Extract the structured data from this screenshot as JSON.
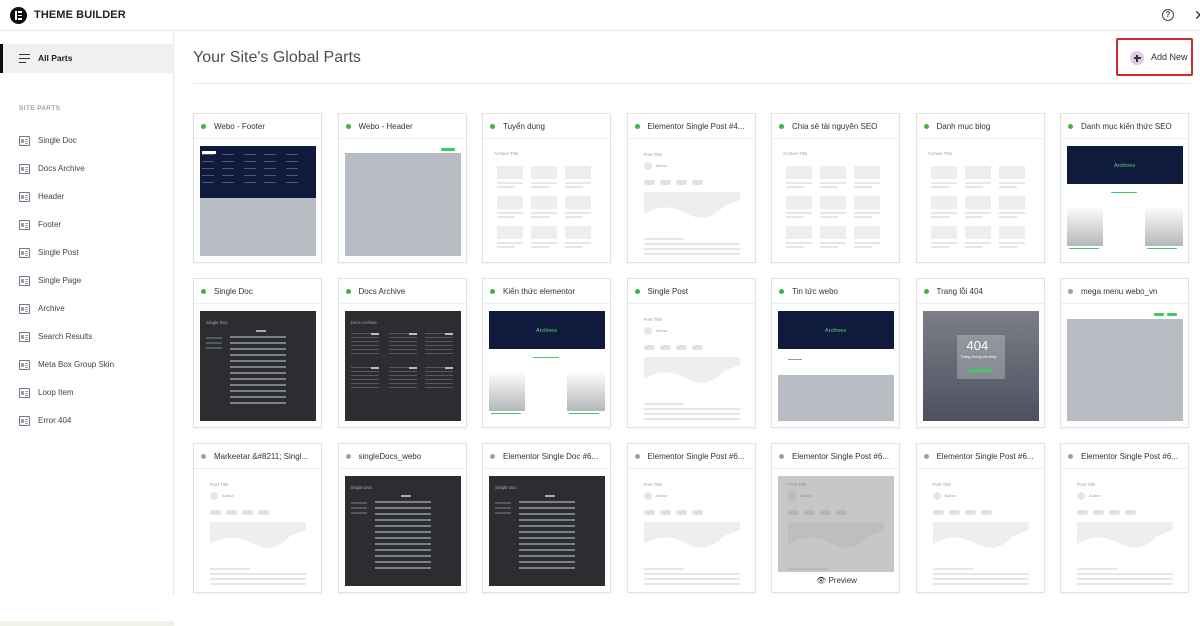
{
  "app": {
    "title": "THEME BUILDER",
    "logo": "elementor-logo-icon"
  },
  "header_icons": {
    "help": "?",
    "close": "✕"
  },
  "sidebar": {
    "all_parts": "All Parts",
    "section_label": "SITE PARTS",
    "items": [
      {
        "label": "Single Doc",
        "icon": "single-doc-icon"
      },
      {
        "label": "Docs Archive",
        "icon": "docs-archive-icon"
      },
      {
        "label": "Header",
        "icon": "header-icon"
      },
      {
        "label": "Footer",
        "icon": "footer-icon"
      },
      {
        "label": "Single Post",
        "icon": "single-post-icon"
      },
      {
        "label": "Single Page",
        "icon": "single-page-icon"
      },
      {
        "label": "Archive",
        "icon": "archive-icon"
      },
      {
        "label": "Search Results",
        "icon": "search-results-icon"
      },
      {
        "label": "Meta Box Group Skin",
        "icon": "meta-box-icon"
      },
      {
        "label": "Loop Item",
        "icon": "loop-item-icon"
      },
      {
        "label": "Error 404",
        "icon": "error-404-icon"
      }
    ]
  },
  "main": {
    "title": "Your Site's Global Parts",
    "add_new": "Add New",
    "preview_label": "Preview",
    "cards": [
      {
        "title": "Webo - Footer",
        "active": true,
        "thumb": "footer"
      },
      {
        "title": "Webo - Header",
        "active": true,
        "thumb": "header"
      },
      {
        "title": "Tuyển dụng",
        "active": true,
        "thumb": "archive-grid"
      },
      {
        "title": "Elementor Single Post #4...",
        "active": true,
        "thumb": "post"
      },
      {
        "title": "Chia sẻ tài nguyên SEO",
        "active": true,
        "thumb": "archive-grid"
      },
      {
        "title": "Danh mục blog",
        "active": true,
        "thumb": "archive-grid"
      },
      {
        "title": "Danh mục kiến thức SEO",
        "active": true,
        "thumb": "archives-navy"
      },
      {
        "title": "Single Doc",
        "active": true,
        "thumb": "dark-doc"
      },
      {
        "title": "Docs Archive",
        "active": true,
        "thumb": "dark-archive"
      },
      {
        "title": "Kiến thức elementor",
        "active": true,
        "thumb": "archives-navy"
      },
      {
        "title": "Single Post",
        "active": true,
        "thumb": "post"
      },
      {
        "title": "Tin tức webo",
        "active": true,
        "thumb": "news"
      },
      {
        "title": "Trang lỗi 404",
        "active": true,
        "thumb": "error404"
      },
      {
        "title": "mega menu webo_vn",
        "active": false,
        "thumb": "mega"
      },
      {
        "title": "Markeetar &#8211; Singl...",
        "active": false,
        "thumb": "post"
      },
      {
        "title": "singleDocs_webo",
        "active": false,
        "thumb": "dark-doc"
      },
      {
        "title": "Elementor Single Doc #6...",
        "active": false,
        "thumb": "dark-doc"
      },
      {
        "title": "Elementor Single Post #6...",
        "active": false,
        "thumb": "post"
      },
      {
        "title": "Elementor Single Post #6...",
        "active": false,
        "thumb": "post-hover"
      },
      {
        "title": "Elementor Single Post #6...",
        "active": false,
        "thumb": "post"
      },
      {
        "title": "Elementor Single Post #6...",
        "active": false,
        "thumb": "post"
      }
    ]
  },
  "thumb_text": {
    "archive_title": "Archive Title",
    "post_title": "Post Title",
    "author": "Author",
    "archives": "Archives",
    "single_doc": "Single Doc",
    "docs_archive": "Docs Archive",
    "error_code": "404",
    "error_msg": "Trang không tìm thấy"
  },
  "colors": {
    "accent_active": "#39b54a",
    "inactive": "#9aa1a8",
    "highlight": "#d22a2a",
    "add_icon": "#e6c6ec"
  }
}
